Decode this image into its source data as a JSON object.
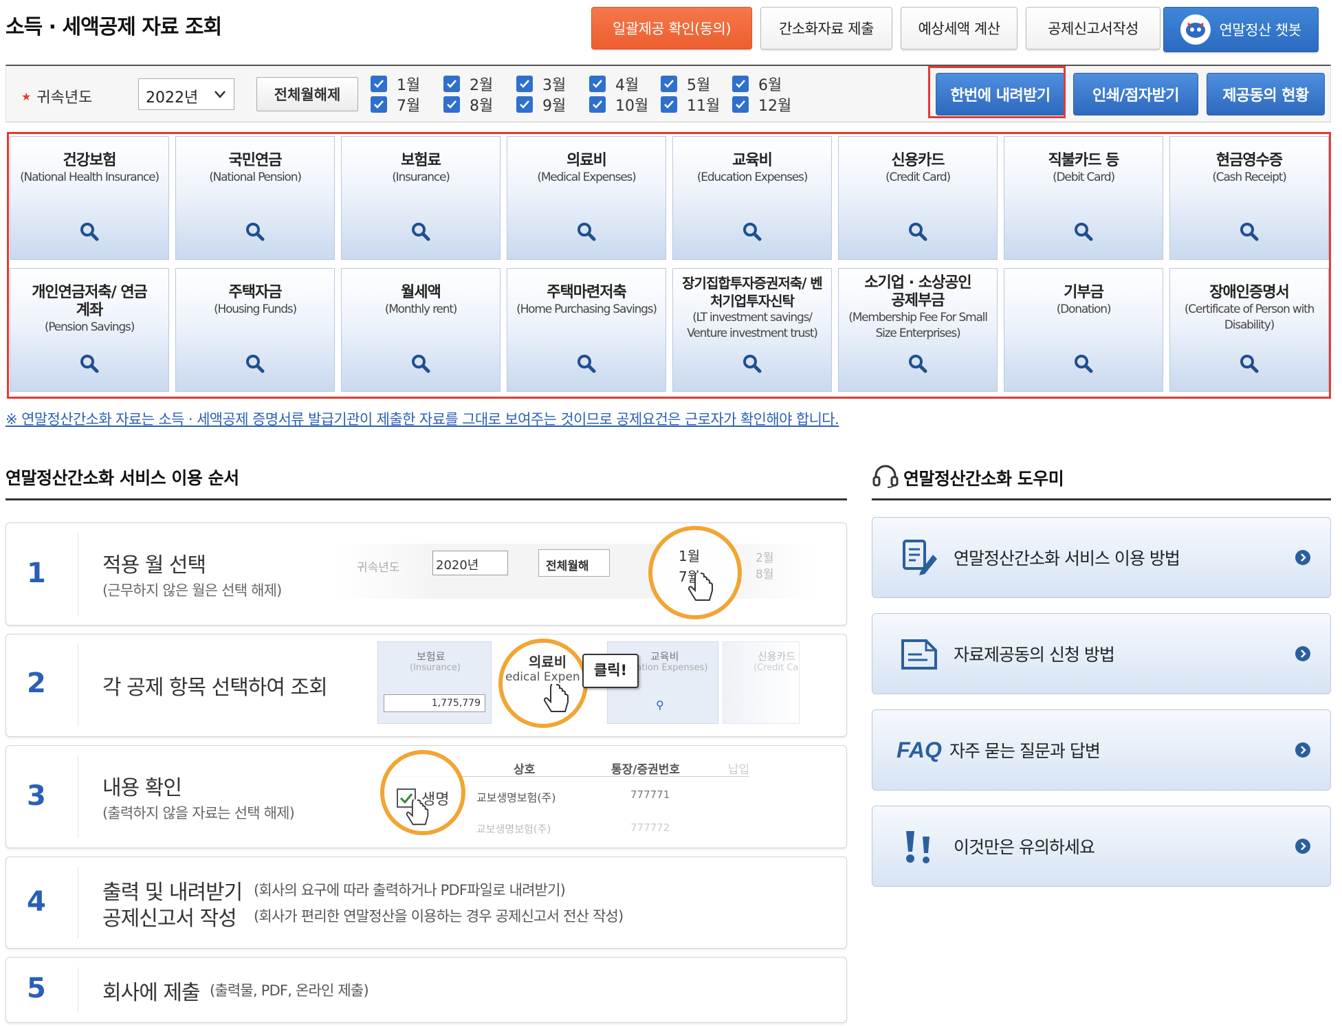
{
  "page_title": "소득 · 세액공제 자료 조회",
  "top_buttons": {
    "batch_consent": "일괄제공 확인(동의)",
    "submit_simplified": "간소화자료 제출",
    "estimate_tax": "예상세액 계산",
    "write_deduction": "공제신고서작성",
    "chatbot": "연말정산 챗봇"
  },
  "filter": {
    "year_label": "귀속년도",
    "year_value": "2022년",
    "deselect_all": "전체월해제",
    "months": [
      "1월",
      "2월",
      "3월",
      "4월",
      "5월",
      "6월",
      "7월",
      "8월",
      "9월",
      "10월",
      "11월",
      "12월"
    ],
    "download_all": "한번에 내려받기",
    "print_braille": "인쇄/점자받기",
    "consent_status": "제공동의 현황"
  },
  "categories": [
    {
      "ko": "건강보험",
      "en": "(National Health Insurance)"
    },
    {
      "ko": "국민연금",
      "en": "(National Pension)"
    },
    {
      "ko": "보험료",
      "en": "(Insurance)"
    },
    {
      "ko": "의료비",
      "en": "(Medical Expenses)"
    },
    {
      "ko": "교육비",
      "en": "(Education Expenses)"
    },
    {
      "ko": "신용카드",
      "en": "(Credit Card)"
    },
    {
      "ko": "직불카드 등",
      "en": "(Debit Card)"
    },
    {
      "ko": "현금영수증",
      "en": "(Cash Receipt)"
    },
    {
      "ko": "개인연금저축/ 연금계좌",
      "en": "(Pension Savings)"
    },
    {
      "ko": "주택자금",
      "en": "(Housing Funds)"
    },
    {
      "ko": "월세액",
      "en": "(Monthly rent)"
    },
    {
      "ko": "주택마련저축",
      "en": "(Home Purchasing Savings)"
    },
    {
      "ko": "장기집합투자증권저축/ 벤처기업투자신탁",
      "en": "(LT investment savings/ Venture investment trust)"
    },
    {
      "ko": "소기업 · 소상공인 공제부금",
      "en": "(Membership Fee For Small Size Enterprises)"
    },
    {
      "ko": "기부금",
      "en": "(Donation)"
    },
    {
      "ko": "장애인증명서",
      "en": "(Certificate of Person with Disability)"
    }
  ],
  "notice": "※ 연말정산간소화 자료는 소득 · 세액공제 증명서류 발급기관이 제출한 자료를 그대로 보여주는 것이므로 공제요건은 근로자가 확인해야 합니다.",
  "steps_section_title": "연말정산간소화 서비스 이용 순서",
  "steps": [
    {
      "num": "1",
      "title": "적용 월 선택",
      "sub": "(근무하지 않은 월은 선택 해제)"
    },
    {
      "num": "2",
      "title": "각 공제 항목 선택하여 조회",
      "sub": ""
    },
    {
      "num": "3",
      "title": "내용 확인",
      "sub": "(출력하지 않을 자료는 선택 해제)"
    },
    {
      "num": "4",
      "title": "출력 및 내려받기",
      "title2": "공제신고서 작성",
      "side1": "(회사의 요구에 따라 출력하거나 PDF파일로 내려받기)",
      "side2": "(회사가 편리한 연말정산을 이용하는 경우 공제신고서 전산 작성)"
    },
    {
      "num": "5",
      "title": "회사에 제출",
      "side1": "(출력물, PDF, 온라인 제출)"
    }
  ],
  "illustrations": {
    "s1_year_label": "귀속년도",
    "s1_year": "2020년",
    "s1_btn": "전체월해",
    "s1_m1": "1월",
    "s1_m7": "7월",
    "s1_m2": "2월",
    "s1_m8": "8월",
    "s2_c1_ko": "보험료",
    "s2_c1_en": "(Insurance)",
    "s2_c1_val": "1,775,779",
    "s2_c2_ko": "의료비",
    "s2_c2_en": "edical Expen",
    "s2_c3_ko": "교육비",
    "s2_c3_en": "ucation Expenses)",
    "s2_c4_ko": "신용카드",
    "s2_c4_en": "(Credit Ca",
    "s2_click": "클릭!",
    "s3_h1": "상호",
    "s3_h2": "통장/증권번호",
    "s3_h3": "납입",
    "s3_r1_name": "생명",
    "s3_r1_co": "교보생명보험(주)",
    "s3_r1_no": "777771",
    "s3_r2_co": "교보생명보험(주)",
    "s3_r2_no": "777772"
  },
  "helper_section_title": "연말정산간소화 도우미",
  "helper_items": [
    {
      "label": "연말정산간소화 서비스 이용 방법"
    },
    {
      "label": "자료제공동의 신청 방법"
    },
    {
      "prefix": "FAQ",
      "label": "자주 묻는 질문과 답변"
    },
    {
      "label": "이것만은 유의하세요"
    }
  ],
  "colors": {
    "accent_blue": "#2d69bf",
    "orange": "#ec5e2f",
    "highlight_red": "#e53935",
    "step_number": "#2a5fb8"
  }
}
